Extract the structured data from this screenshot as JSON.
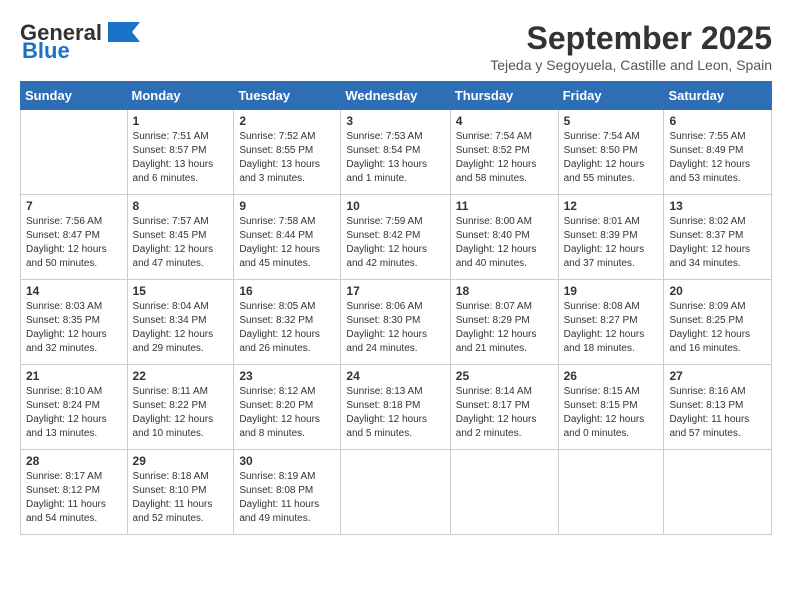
{
  "header": {
    "logo_general": "General",
    "logo_blue": "Blue",
    "month_title": "September 2025",
    "subtitle": "Tejeda y Segoyuela, Castille and Leon, Spain"
  },
  "columns": [
    "Sunday",
    "Monday",
    "Tuesday",
    "Wednesday",
    "Thursday",
    "Friday",
    "Saturday"
  ],
  "weeks": [
    [
      {
        "day": "",
        "info": ""
      },
      {
        "day": "1",
        "info": "Sunrise: 7:51 AM\nSunset: 8:57 PM\nDaylight: 13 hours\nand 6 minutes."
      },
      {
        "day": "2",
        "info": "Sunrise: 7:52 AM\nSunset: 8:55 PM\nDaylight: 13 hours\nand 3 minutes."
      },
      {
        "day": "3",
        "info": "Sunrise: 7:53 AM\nSunset: 8:54 PM\nDaylight: 13 hours\nand 1 minute."
      },
      {
        "day": "4",
        "info": "Sunrise: 7:54 AM\nSunset: 8:52 PM\nDaylight: 12 hours\nand 58 minutes."
      },
      {
        "day": "5",
        "info": "Sunrise: 7:54 AM\nSunset: 8:50 PM\nDaylight: 12 hours\nand 55 minutes."
      },
      {
        "day": "6",
        "info": "Sunrise: 7:55 AM\nSunset: 8:49 PM\nDaylight: 12 hours\nand 53 minutes."
      }
    ],
    [
      {
        "day": "7",
        "info": "Sunrise: 7:56 AM\nSunset: 8:47 PM\nDaylight: 12 hours\nand 50 minutes."
      },
      {
        "day": "8",
        "info": "Sunrise: 7:57 AM\nSunset: 8:45 PM\nDaylight: 12 hours\nand 47 minutes."
      },
      {
        "day": "9",
        "info": "Sunrise: 7:58 AM\nSunset: 8:44 PM\nDaylight: 12 hours\nand 45 minutes."
      },
      {
        "day": "10",
        "info": "Sunrise: 7:59 AM\nSunset: 8:42 PM\nDaylight: 12 hours\nand 42 minutes."
      },
      {
        "day": "11",
        "info": "Sunrise: 8:00 AM\nSunset: 8:40 PM\nDaylight: 12 hours\nand 40 minutes."
      },
      {
        "day": "12",
        "info": "Sunrise: 8:01 AM\nSunset: 8:39 PM\nDaylight: 12 hours\nand 37 minutes."
      },
      {
        "day": "13",
        "info": "Sunrise: 8:02 AM\nSunset: 8:37 PM\nDaylight: 12 hours\nand 34 minutes."
      }
    ],
    [
      {
        "day": "14",
        "info": "Sunrise: 8:03 AM\nSunset: 8:35 PM\nDaylight: 12 hours\nand 32 minutes."
      },
      {
        "day": "15",
        "info": "Sunrise: 8:04 AM\nSunset: 8:34 PM\nDaylight: 12 hours\nand 29 minutes."
      },
      {
        "day": "16",
        "info": "Sunrise: 8:05 AM\nSunset: 8:32 PM\nDaylight: 12 hours\nand 26 minutes."
      },
      {
        "day": "17",
        "info": "Sunrise: 8:06 AM\nSunset: 8:30 PM\nDaylight: 12 hours\nand 24 minutes."
      },
      {
        "day": "18",
        "info": "Sunrise: 8:07 AM\nSunset: 8:29 PM\nDaylight: 12 hours\nand 21 minutes."
      },
      {
        "day": "19",
        "info": "Sunrise: 8:08 AM\nSunset: 8:27 PM\nDaylight: 12 hours\nand 18 minutes."
      },
      {
        "day": "20",
        "info": "Sunrise: 8:09 AM\nSunset: 8:25 PM\nDaylight: 12 hours\nand 16 minutes."
      }
    ],
    [
      {
        "day": "21",
        "info": "Sunrise: 8:10 AM\nSunset: 8:24 PM\nDaylight: 12 hours\nand 13 minutes."
      },
      {
        "day": "22",
        "info": "Sunrise: 8:11 AM\nSunset: 8:22 PM\nDaylight: 12 hours\nand 10 minutes."
      },
      {
        "day": "23",
        "info": "Sunrise: 8:12 AM\nSunset: 8:20 PM\nDaylight: 12 hours\nand 8 minutes."
      },
      {
        "day": "24",
        "info": "Sunrise: 8:13 AM\nSunset: 8:18 PM\nDaylight: 12 hours\nand 5 minutes."
      },
      {
        "day": "25",
        "info": "Sunrise: 8:14 AM\nSunset: 8:17 PM\nDaylight: 12 hours\nand 2 minutes."
      },
      {
        "day": "26",
        "info": "Sunrise: 8:15 AM\nSunset: 8:15 PM\nDaylight: 12 hours\nand 0 minutes."
      },
      {
        "day": "27",
        "info": "Sunrise: 8:16 AM\nSunset: 8:13 PM\nDaylight: 11 hours\nand 57 minutes."
      }
    ],
    [
      {
        "day": "28",
        "info": "Sunrise: 8:17 AM\nSunset: 8:12 PM\nDaylight: 11 hours\nand 54 minutes."
      },
      {
        "day": "29",
        "info": "Sunrise: 8:18 AM\nSunset: 8:10 PM\nDaylight: 11 hours\nand 52 minutes."
      },
      {
        "day": "30",
        "info": "Sunrise: 8:19 AM\nSunset: 8:08 PM\nDaylight: 11 hours\nand 49 minutes."
      },
      {
        "day": "",
        "info": ""
      },
      {
        "day": "",
        "info": ""
      },
      {
        "day": "",
        "info": ""
      },
      {
        "day": "",
        "info": ""
      }
    ]
  ]
}
